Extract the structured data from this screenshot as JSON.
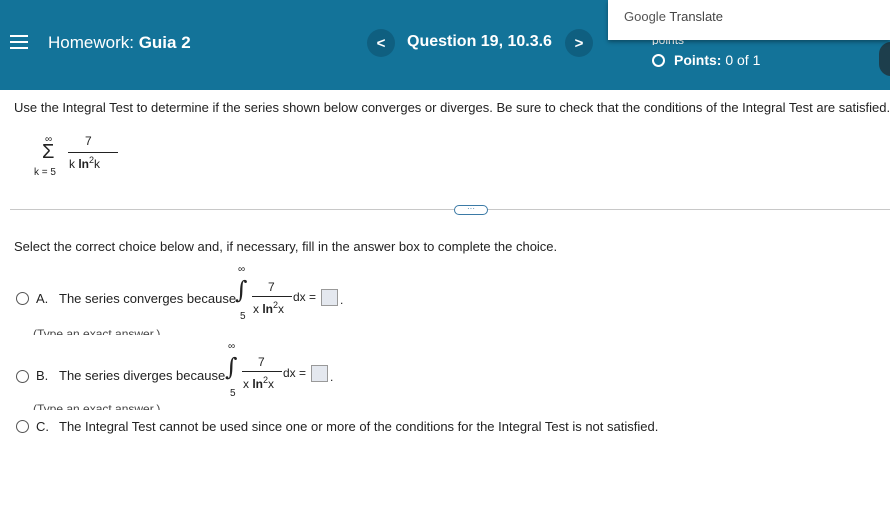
{
  "header": {
    "hw_label": "Homework:",
    "hw_name": "Guia 2",
    "prev_symbol": "<",
    "next_symbol": ">",
    "question": "Question 19, 10.3.6",
    "points_word": "points",
    "points_prefix": "Points:",
    "points_value": "0 of 1"
  },
  "google_translate": {
    "brand": "Google",
    "product": "Translate"
  },
  "problem": {
    "instructions": "Use the Integral Test to determine if the series shown below converges or diverges. Be sure to check that the conditions of the Integral Test are satisfied.",
    "series": {
      "upper": "∞",
      "sigma": "Σ",
      "lower": "k = 5",
      "numerator": "7",
      "den_k": "k",
      "den_ln": "ln",
      "den_exp": "2",
      "den_k2": "k"
    }
  },
  "more_button": "···",
  "select_text": "Select the correct choice below and, if necessary, fill in the answer box to complete the choice.",
  "choices": {
    "a": {
      "letter": "A.",
      "text": "The series converges because",
      "upper": "∞",
      "lower": "5",
      "integral": "∫",
      "numerator": "7",
      "den_x": "x",
      "den_ln": "ln",
      "den_exp": "2",
      "den_x2": "x",
      "dx": "dx =",
      "period": ".",
      "hint": "(Type an exact answer.)"
    },
    "b": {
      "letter": "B.",
      "text": "The series diverges because",
      "upper": "∞",
      "lower": "5",
      "integral": "∫",
      "numerator": "7",
      "den_x": "x",
      "den_ln": "ln",
      "den_exp": "2",
      "den_x2": "x",
      "dx": "dx =",
      "period": ".",
      "hint": "(Type an exact answer.)"
    },
    "c": {
      "letter": "C.",
      "text": "The Integral Test cannot be used since one or more of the conditions for the Integral Test is not satisfied."
    }
  },
  "colors": {
    "header_bg": "#137399",
    "nav_btn": "#0f5f80",
    "answer_box": "#e4e8ef"
  }
}
